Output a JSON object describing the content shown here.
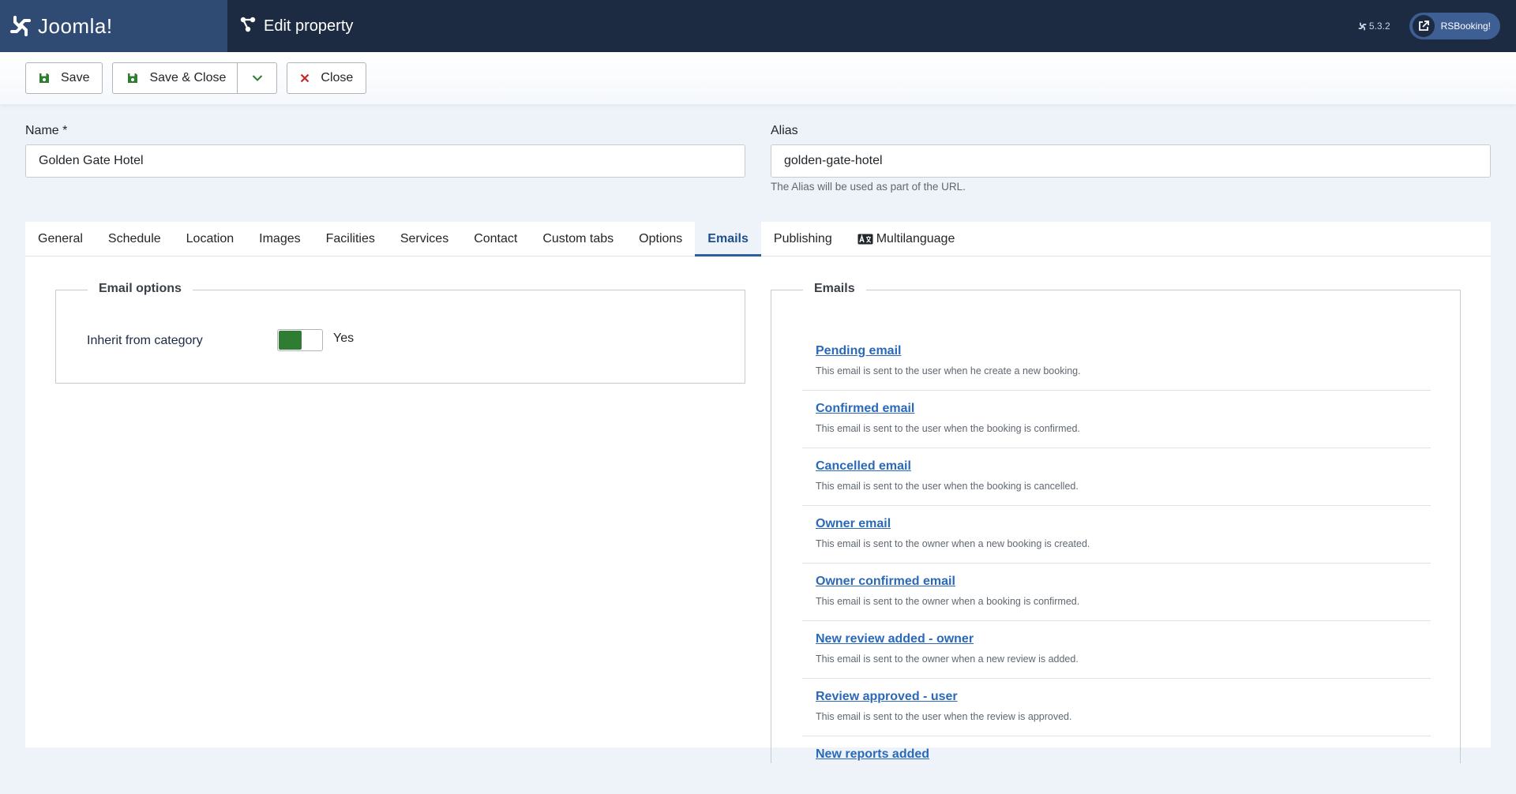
{
  "header": {
    "logo_text": "Joomla!",
    "page_title": "Edit property",
    "version": "5.3.2",
    "rsbooking_label": "RSBooking!"
  },
  "toolbar": {
    "save_label": "Save",
    "save_close_label": "Save & Close",
    "close_label": "Close"
  },
  "form": {
    "name_label": "Name *",
    "name_value": "Golden Gate Hotel",
    "alias_label": "Alias",
    "alias_value": "golden-gate-hotel",
    "alias_help": "The Alias will be used as part of the URL."
  },
  "tabs": [
    {
      "label": "General"
    },
    {
      "label": "Schedule"
    },
    {
      "label": "Location"
    },
    {
      "label": "Images"
    },
    {
      "label": "Facilities"
    },
    {
      "label": "Services"
    },
    {
      "label": "Contact"
    },
    {
      "label": "Custom tabs"
    },
    {
      "label": "Options"
    },
    {
      "label": "Emails"
    },
    {
      "label": "Publishing"
    },
    {
      "label": "Multilanguage"
    }
  ],
  "email_options": {
    "legend": "Email options",
    "inherit_label": "Inherit from category",
    "inherit_value": "Yes"
  },
  "emails": {
    "legend": "Emails",
    "items": [
      {
        "title": "Pending email",
        "desc": "This email is sent to the user when he create a new booking."
      },
      {
        "title": "Confirmed email",
        "desc": "This email is sent to the user when the booking is confirmed."
      },
      {
        "title": "Cancelled email",
        "desc": "This email is sent to the user when the booking is cancelled."
      },
      {
        "title": "Owner email",
        "desc": "This email is sent to the owner when a new booking is created."
      },
      {
        "title": "Owner confirmed email",
        "desc": "This email is sent to the owner when a booking is confirmed."
      },
      {
        "title": "New review added - owner",
        "desc": "This email is sent to the owner when a new review is added."
      },
      {
        "title": "Review approved - user",
        "desc": "This email is sent to the user when the review is approved."
      },
      {
        "title": "New reports added",
        "desc": ""
      }
    ]
  },
  "colors": {
    "header_bg": "#1c2b42",
    "logo_bg": "#2f4b74",
    "accent": "#2f5da1",
    "link": "#2a69b8",
    "toggle_on": "#2e7d32",
    "close_x": "#c52827"
  }
}
